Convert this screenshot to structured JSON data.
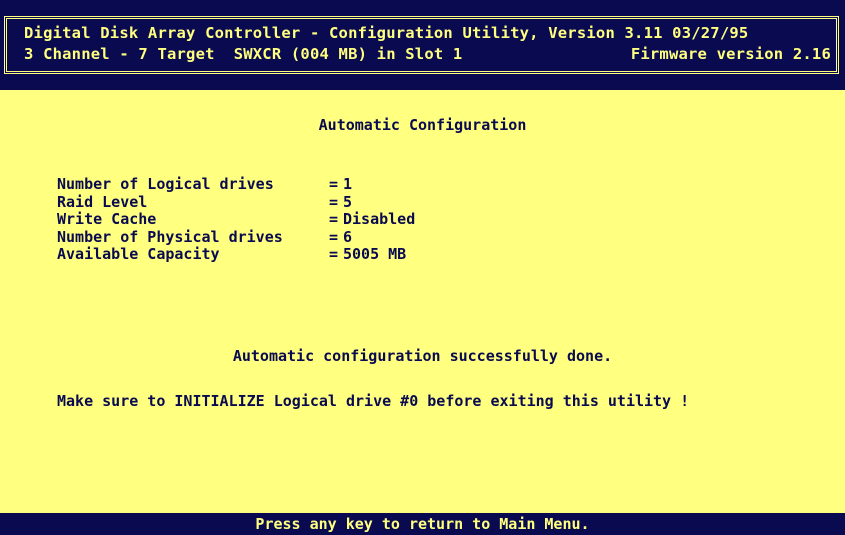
{
  "header": {
    "line1": "Digital Disk Array Controller - Configuration Utility, Version 3.11 03/27/95",
    "line2_left": "3 Channel - 7 Target  SWXCR (004 MB) in Slot 1",
    "line2_right": "Firmware version 2.16"
  },
  "main": {
    "title": "Automatic Configuration",
    "settings": [
      {
        "label": "Number of Logical drives",
        "value": "1"
      },
      {
        "label": "Raid Level",
        "value": "5"
      },
      {
        "label": "Write Cache",
        "value": "Disabled"
      },
      {
        "label": "Number of Physical drives",
        "value": "6"
      },
      {
        "label": "Available Capacity",
        "value": "5005 MB"
      }
    ],
    "separator": "=",
    "success_message": "Automatic configuration successfully done.",
    "warning_message": "Make sure to INITIALIZE Logical drive #0 before exiting this utility !"
  },
  "status_bar": {
    "text": "Press any key to return to Main Menu."
  },
  "colors": {
    "background": "#ffff80",
    "foreground": "#0a0a50",
    "bar_background": "#0a0a50",
    "bar_text": "#ffff80"
  }
}
